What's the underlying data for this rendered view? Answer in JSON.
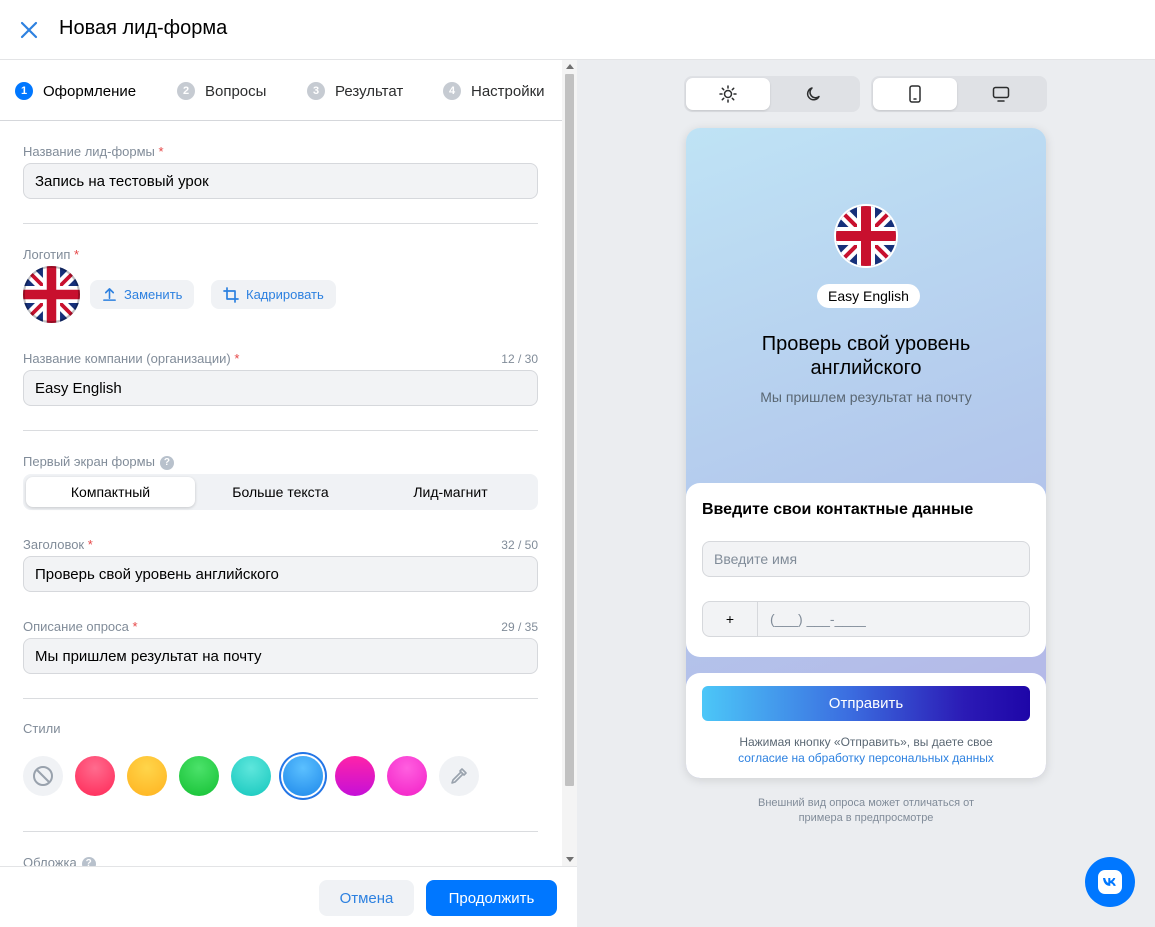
{
  "header": {
    "title": "Новая лид-форма"
  },
  "steps": [
    {
      "num": "1",
      "label": "Оформление",
      "active": true
    },
    {
      "num": "2",
      "label": "Вопросы"
    },
    {
      "num": "3",
      "label": "Результат"
    },
    {
      "num": "4",
      "label": "Настройки"
    }
  ],
  "form": {
    "form_name": {
      "label": "Название лид-формы",
      "required": "*",
      "value": "Запись на тестовый урок"
    },
    "logo": {
      "label": "Логотип",
      "required": "*",
      "replace_label": "Заменить",
      "crop_label": "Кадрировать"
    },
    "company": {
      "label": "Название компании (организации)",
      "required": "*",
      "counter": "12 / 30",
      "value": "Easy English"
    },
    "first_screen": {
      "label": "Первый экран формы",
      "help": "?",
      "options": [
        "Компактный",
        "Больше текста",
        "Лид-магнит"
      ],
      "selected": "Компактный"
    },
    "heading": {
      "label": "Заголовок",
      "required": "*",
      "counter": "32 / 50",
      "value": "Проверь свой уровень английского"
    },
    "description": {
      "label": "Описание опроса",
      "required": "*",
      "counter": "29 / 35",
      "value": "Мы пришлем результат на почту"
    },
    "styles": {
      "label": "Стили",
      "swatches": [
        {
          "name": "none",
          "icon": "none-icon"
        },
        {
          "name": "red",
          "color": "#ff3a6a"
        },
        {
          "name": "yellow",
          "color": "#ffc226"
        },
        {
          "name": "green",
          "color": "#1fcc3d"
        },
        {
          "name": "turquoise",
          "color": "#1ed1c8"
        },
        {
          "name": "blue",
          "color": "#2a9bf2",
          "selected": true
        },
        {
          "name": "purple",
          "color": "#e515c4"
        },
        {
          "name": "pink",
          "color": "#ff3ad9"
        },
        {
          "name": "custom",
          "icon": "eyedropper-icon"
        }
      ]
    },
    "cover": {
      "label": "Обложка",
      "help": "?"
    }
  },
  "footer": {
    "cancel": "Отмена",
    "continue": "Продолжить"
  },
  "preview": {
    "theme_toggle": {
      "light_icon": "sun-icon",
      "dark_icon": "moon-icon",
      "selected": "light"
    },
    "device_toggle": {
      "mobile_icon": "phone-icon",
      "desktop_icon": "desktop-icon",
      "selected": "mobile"
    },
    "company": "Easy English",
    "title": "Проверь свой уровень английского",
    "description": "Мы пришлем результат на почту",
    "contact_title": "Введите свои контактные данные",
    "name_placeholder": "Введите имя",
    "phone_prefix": "+",
    "phone_mask": "(___) ___-____",
    "submit": "Отправить",
    "consent_text": "Нажимая кнопку «Отправить», вы даете свое",
    "consent_link": "согласие на обработку персональных данных",
    "note": "Внешний вид опроса может отличаться от примера в предпросмотре"
  },
  "colors": {
    "accent": "#0077ff",
    "link": "#2d81e0",
    "required": "#e64646"
  }
}
